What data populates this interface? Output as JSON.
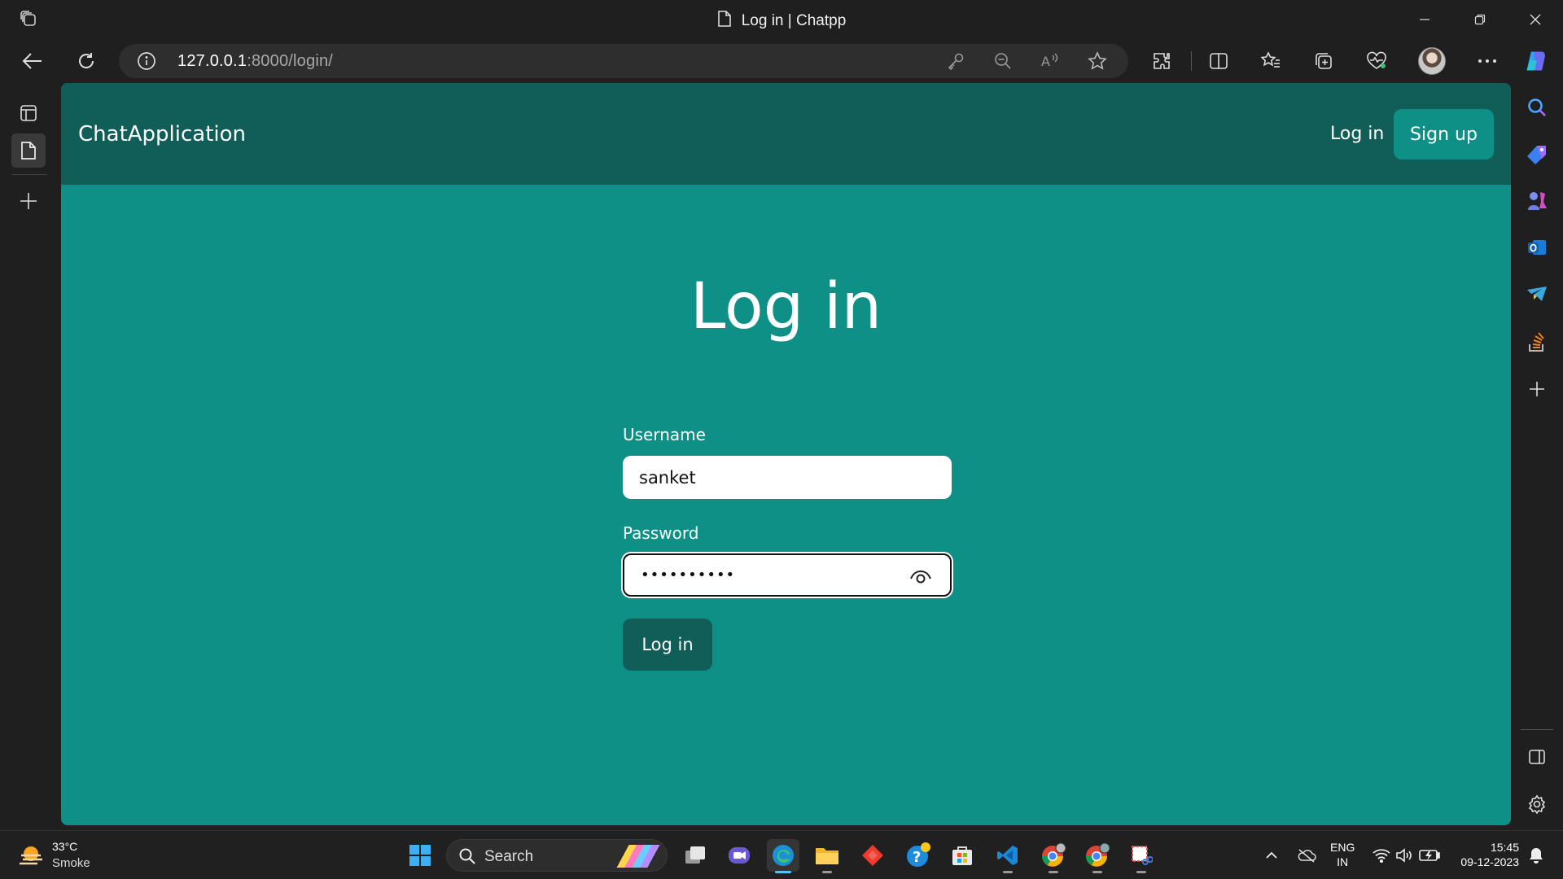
{
  "browser": {
    "tab_title": "Log in | Chatpp",
    "address": {
      "host": "127.0.0.1",
      "rest": ":8000/login/"
    }
  },
  "site": {
    "brand": "ChatApplication",
    "nav": {
      "login": "Log in",
      "signup": "Sign up"
    }
  },
  "form": {
    "title": "Log in",
    "username_label": "Username",
    "username_value": "sanket",
    "password_label": "Password",
    "password_value": "••••••••••",
    "submit_label": "Log in"
  },
  "taskbar": {
    "weather": {
      "temp": "33°C",
      "desc": "Smoke"
    },
    "search_label": "Search",
    "lang": {
      "line1": "ENG",
      "line2": "IN"
    },
    "clock": {
      "time": "15:45",
      "date": "09-12-2023"
    }
  },
  "colors": {
    "page_bg": "#0f9086",
    "header_bg": "#115e59",
    "chrome_bg": "#1f1f1f"
  },
  "icons": {
    "left_strip": [
      "tab-actions-icon",
      "page-tab-icon",
      "new-tab-plus-icon"
    ],
    "toolbar": [
      "key-icon",
      "zoom-out-icon",
      "read-aloud-icon",
      "favorite-star-icon",
      "extensions-icon",
      "split-screen-icon",
      "favorites-icon",
      "collections-icon",
      "performance-icon",
      "more-icon",
      "copilot-icon"
    ],
    "right_sidebar": [
      "search-icon",
      "shopping-tag-icon",
      "games-icon",
      "outlook-icon",
      "telegram-icon",
      "stackoverflow-icon",
      "add-icon",
      "sidebar-toggle-icon",
      "settings-icon"
    ]
  }
}
